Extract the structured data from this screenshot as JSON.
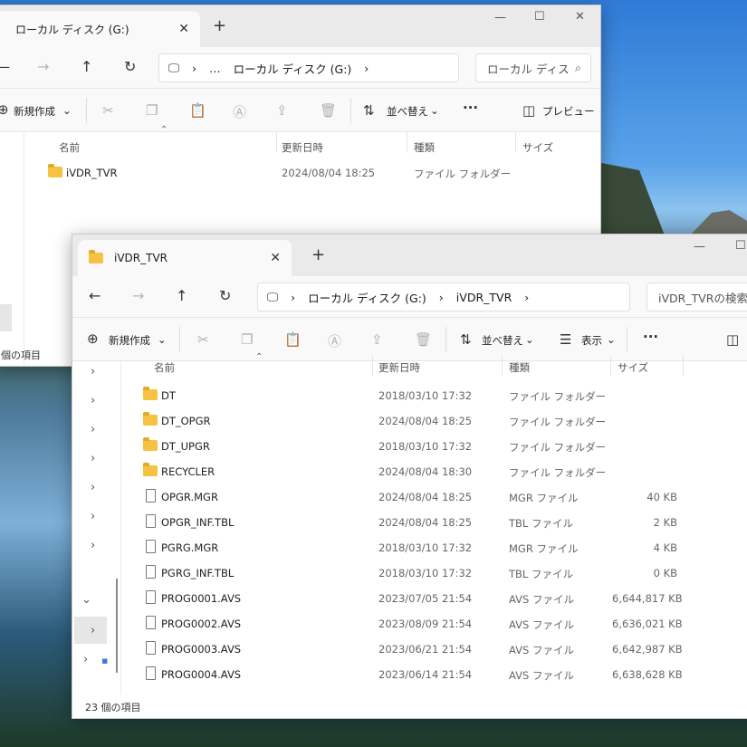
{
  "back": {
    "tab_title": "ローカル ディスク (G:)",
    "breadcrumb": [
      "ローカル ディスク (G:)"
    ],
    "search_placeholder": "ローカル ディス",
    "new_label": "新規作成",
    "sort_label": "並べ替え",
    "preview_label": "プレビュー",
    "columns": [
      "名前",
      "更新日時",
      "種類",
      "サイズ"
    ],
    "rows": [
      {
        "name": "iVDR_TVR",
        "date": "2024/08/04 18:25",
        "type": "ファイル フォルダー",
        "size": ""
      }
    ],
    "status": "個の項目"
  },
  "front": {
    "tab_title": "iVDR_TVR",
    "breadcrumb": [
      "ローカル ディスク (G:)",
      "iVDR_TVR"
    ],
    "search_placeholder": "iVDR_TVRの検索",
    "new_label": "新規作成",
    "sort_label": "並べ替え",
    "view_label": "表示",
    "columns": [
      "名前",
      "更新日時",
      "種類",
      "サイズ"
    ],
    "rows": [
      {
        "name": "DT",
        "date": "2018/03/10 17:32",
        "type": "ファイル フォルダー",
        "size": "",
        "folder": true
      },
      {
        "name": "DT_OPGR",
        "date": "2024/08/04 18:25",
        "type": "ファイル フォルダー",
        "size": "",
        "folder": true
      },
      {
        "name": "DT_UPGR",
        "date": "2018/03/10 17:32",
        "type": "ファイル フォルダー",
        "size": "",
        "folder": true
      },
      {
        "name": "RECYCLER",
        "date": "2024/08/04 18:30",
        "type": "ファイル フォルダー",
        "size": "",
        "folder": true
      },
      {
        "name": "OPGR.MGR",
        "date": "2024/08/04 18:25",
        "type": "MGR ファイル",
        "size": "40 KB",
        "folder": false
      },
      {
        "name": "OPGR_INF.TBL",
        "date": "2024/08/04 18:25",
        "type": "TBL ファイル",
        "size": "2 KB",
        "folder": false
      },
      {
        "name": "PGRG.MGR",
        "date": "2018/03/10 17:32",
        "type": "MGR ファイル",
        "size": "4 KB",
        "folder": false
      },
      {
        "name": "PGRG_INF.TBL",
        "date": "2018/03/10 17:32",
        "type": "TBL ファイル",
        "size": "0 KB",
        "folder": false
      },
      {
        "name": "PROG0001.AVS",
        "date": "2023/07/05 21:54",
        "type": "AVS ファイル",
        "size": "6,644,817 KB",
        "folder": false
      },
      {
        "name": "PROG0002.AVS",
        "date": "2023/08/09 21:54",
        "type": "AVS ファイル",
        "size": "6,636,021 KB",
        "folder": false
      },
      {
        "name": "PROG0003.AVS",
        "date": "2023/06/21 21:54",
        "type": "AVS ファイル",
        "size": "6,642,987 KB",
        "folder": false
      },
      {
        "name": "PROG0004.AVS",
        "date": "2023/06/14 21:54",
        "type": "AVS ファイル",
        "size": "6,638,628 KB",
        "folder": false
      }
    ],
    "status": "23 個の項目"
  }
}
